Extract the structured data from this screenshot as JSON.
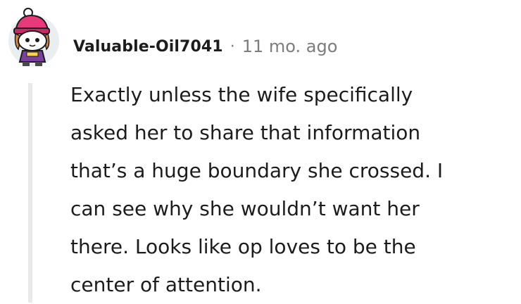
{
  "comment": {
    "author": "Valuable-Oil7041",
    "separator": "·",
    "timestamp": "11 mo. ago",
    "body_lines": [
      "Exactly unless the wife specifically",
      "asked her to share that information",
      "that’s a huge boundary she crossed. I",
      "can see why she wouldn’t want her",
      "there. Looks like op loves to be the",
      "center of attention."
    ]
  },
  "colors": {
    "text": "#1c1c1c",
    "meta": "#7c7c7c",
    "thread_line": "#e9e9e9",
    "avatar_bg": "#e9eef1",
    "hat": "#e83a7b",
    "hair": "#d98b3e",
    "shirt": "#7b3fa0"
  },
  "icons": {
    "avatar": "snoo-avatar-with-beanie"
  }
}
